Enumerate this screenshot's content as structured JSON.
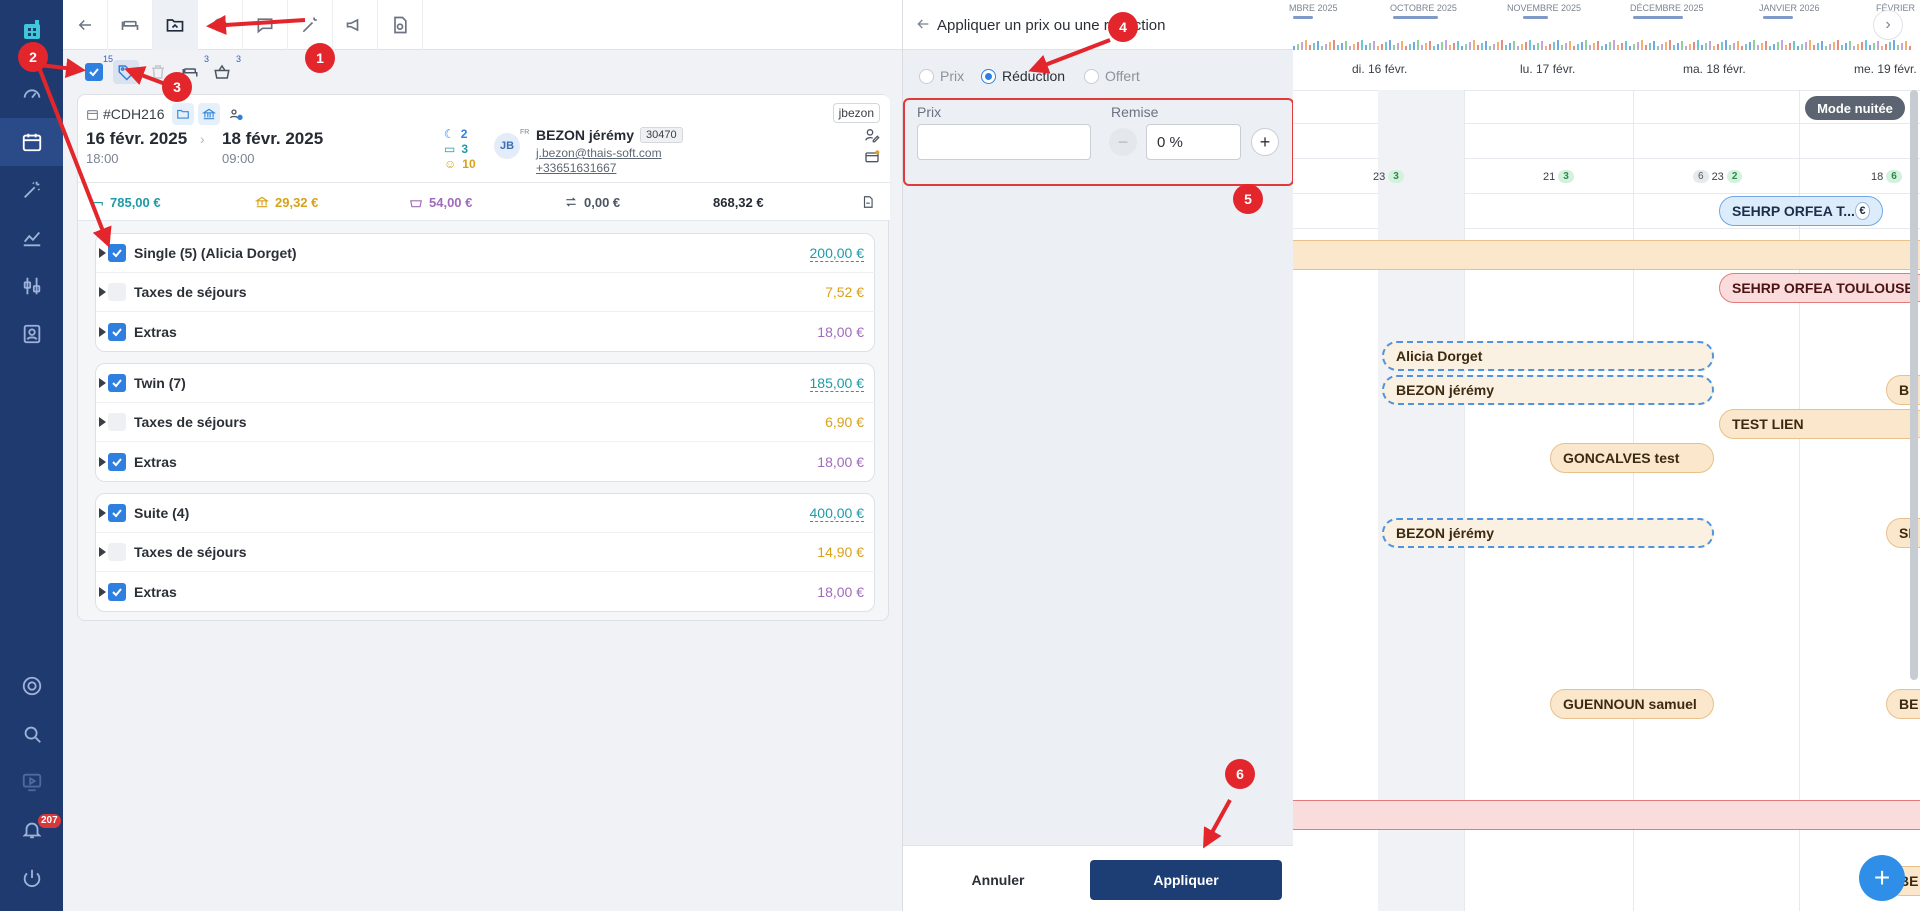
{
  "sidebar": {
    "notification_count": "207"
  },
  "subtoolbar": {
    "select_count": "15",
    "bed_count": "3",
    "basket_count": "3"
  },
  "booking": {
    "ref": "#CDH216",
    "user_tag": "jbezon",
    "arrival_date": "16 févr. 2025",
    "arrival_time": "18:00",
    "departure_date": "18 févr. 2025",
    "departure_time": "09:00",
    "nights": "2",
    "rooms": "3",
    "persons": "10",
    "guest_initials": "JB",
    "guest_lang": "FR",
    "guest_name": "BEZON jérémy",
    "guest_code": "30470",
    "guest_email": "j.bezon@thais-soft.com",
    "guest_phone": "+33651631667"
  },
  "amounts": {
    "stay": "785,00 €",
    "taxes": "29,32 €",
    "extras": "54,00 €",
    "transfer": "0,00 €",
    "total": "868,32 €"
  },
  "groups": [
    {
      "lines": [
        {
          "label": "Single (5) (Alicia Dorget)",
          "value": "200,00 €"
        },
        {
          "label": "Taxes de séjours",
          "value": "7,52 €"
        },
        {
          "label": "Extras",
          "value": "18,00 €"
        }
      ]
    },
    {
      "lines": [
        {
          "label": "Twin (7)",
          "value": "185,00 €"
        },
        {
          "label": "Taxes de séjours",
          "value": "6,90 €"
        },
        {
          "label": "Extras",
          "value": "18,00 €"
        }
      ]
    },
    {
      "lines": [
        {
          "label": "Suite (4)",
          "value": "400,00 €"
        },
        {
          "label": "Taxes de séjours",
          "value": "14,90 €"
        },
        {
          "label": "Extras",
          "value": "18,00 €"
        }
      ]
    }
  ],
  "drawer": {
    "title": "Appliquer un prix ou une réduction",
    "options": [
      "Prix",
      "Réduction",
      "Offert"
    ],
    "selected_option": "Réduction",
    "price_label": "Prix",
    "price_value": "",
    "discount_label": "Remise",
    "discount_value": "0 %",
    "cancel_label": "Annuler",
    "apply_label": "Appliquer"
  },
  "planning": {
    "months": [
      "MBRE 2025",
      "OCTOBRE 2025",
      "NOVEMBRE 2025",
      "DÉCEMBRE 2025",
      "JANVIER 2026",
      "FÉVRIER"
    ],
    "days": [
      "di. 16 févr.",
      "lu. 17 févr.",
      "ma. 18 févr.",
      "me. 19 févr."
    ],
    "counts": {
      "d16_a": "23",
      "d16_b": "3",
      "d17_a": "21",
      "d17_b": "3",
      "d18_a": "6",
      "d18_b": "23",
      "d18_c": "2",
      "d19_a": "18",
      "d19_b": "6"
    },
    "mode_label": "Mode nuitée",
    "reservations": [
      "SEHRP ORFEA T...",
      "SEHRP ORFEA TOULOUSE",
      "Alicia Dorget",
      "BEZON jérémy",
      "TEST LIEN",
      "GONCALVES test",
      "BEZON jérémy",
      "GUENNOUN samuel",
      "BE",
      "SE",
      "BE",
      "BE"
    ],
    "euro_symbol": "€"
  },
  "annotations": [
    "1",
    "2",
    "3",
    "4",
    "5",
    "6"
  ],
  "colors": {
    "sidebar_bg": "#1f3a6e",
    "accent_blue": "#2f7fe1",
    "apply_button": "#1d3e75",
    "teal_amount": "#1f9aa6",
    "amber_amount": "#d8a218",
    "purple_amount": "#a16bbb",
    "annotation_red": "#e2262b"
  }
}
